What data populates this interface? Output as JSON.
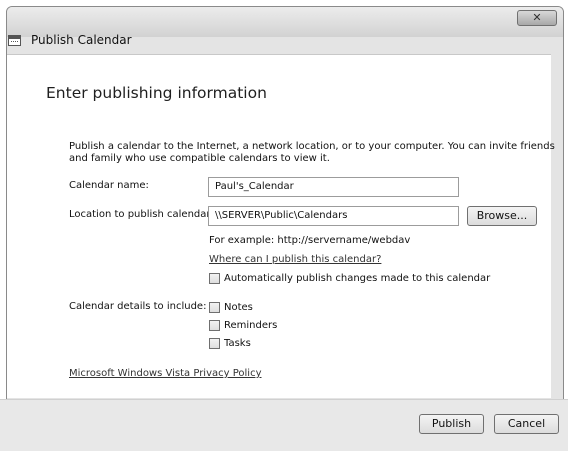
{
  "window": {
    "title": "Publish Calendar",
    "close_label": "✕"
  },
  "page": {
    "heading": "Enter publishing information",
    "description_line1": "Publish a calendar to the Internet, a network location, or to your computer. You can invite friends",
    "description_line2": "and family who use compatible calendars to view it."
  },
  "form": {
    "calendar_name_label": "Calendar name:",
    "calendar_name_value": "Paul's_Calendar",
    "location_label": "Location to publish calendar:",
    "location_value": "\\\\SERVER\\Public\\Calendars",
    "browse_label": "Browse...",
    "example_text": "For example: http://servername/webdav",
    "where_link": "Where can I publish this calendar?",
    "auto_publish_label": "Automatically publish changes made to this calendar",
    "details_label": "Calendar details to include:",
    "details_options": [
      {
        "label": "Notes",
        "checked": false
      },
      {
        "label": "Reminders",
        "checked": false
      },
      {
        "label": "Tasks",
        "checked": false
      }
    ],
    "privacy_link": "Microsoft Windows Vista Privacy Policy"
  },
  "footer": {
    "publish_label": "Publish",
    "cancel_label": "Cancel"
  }
}
